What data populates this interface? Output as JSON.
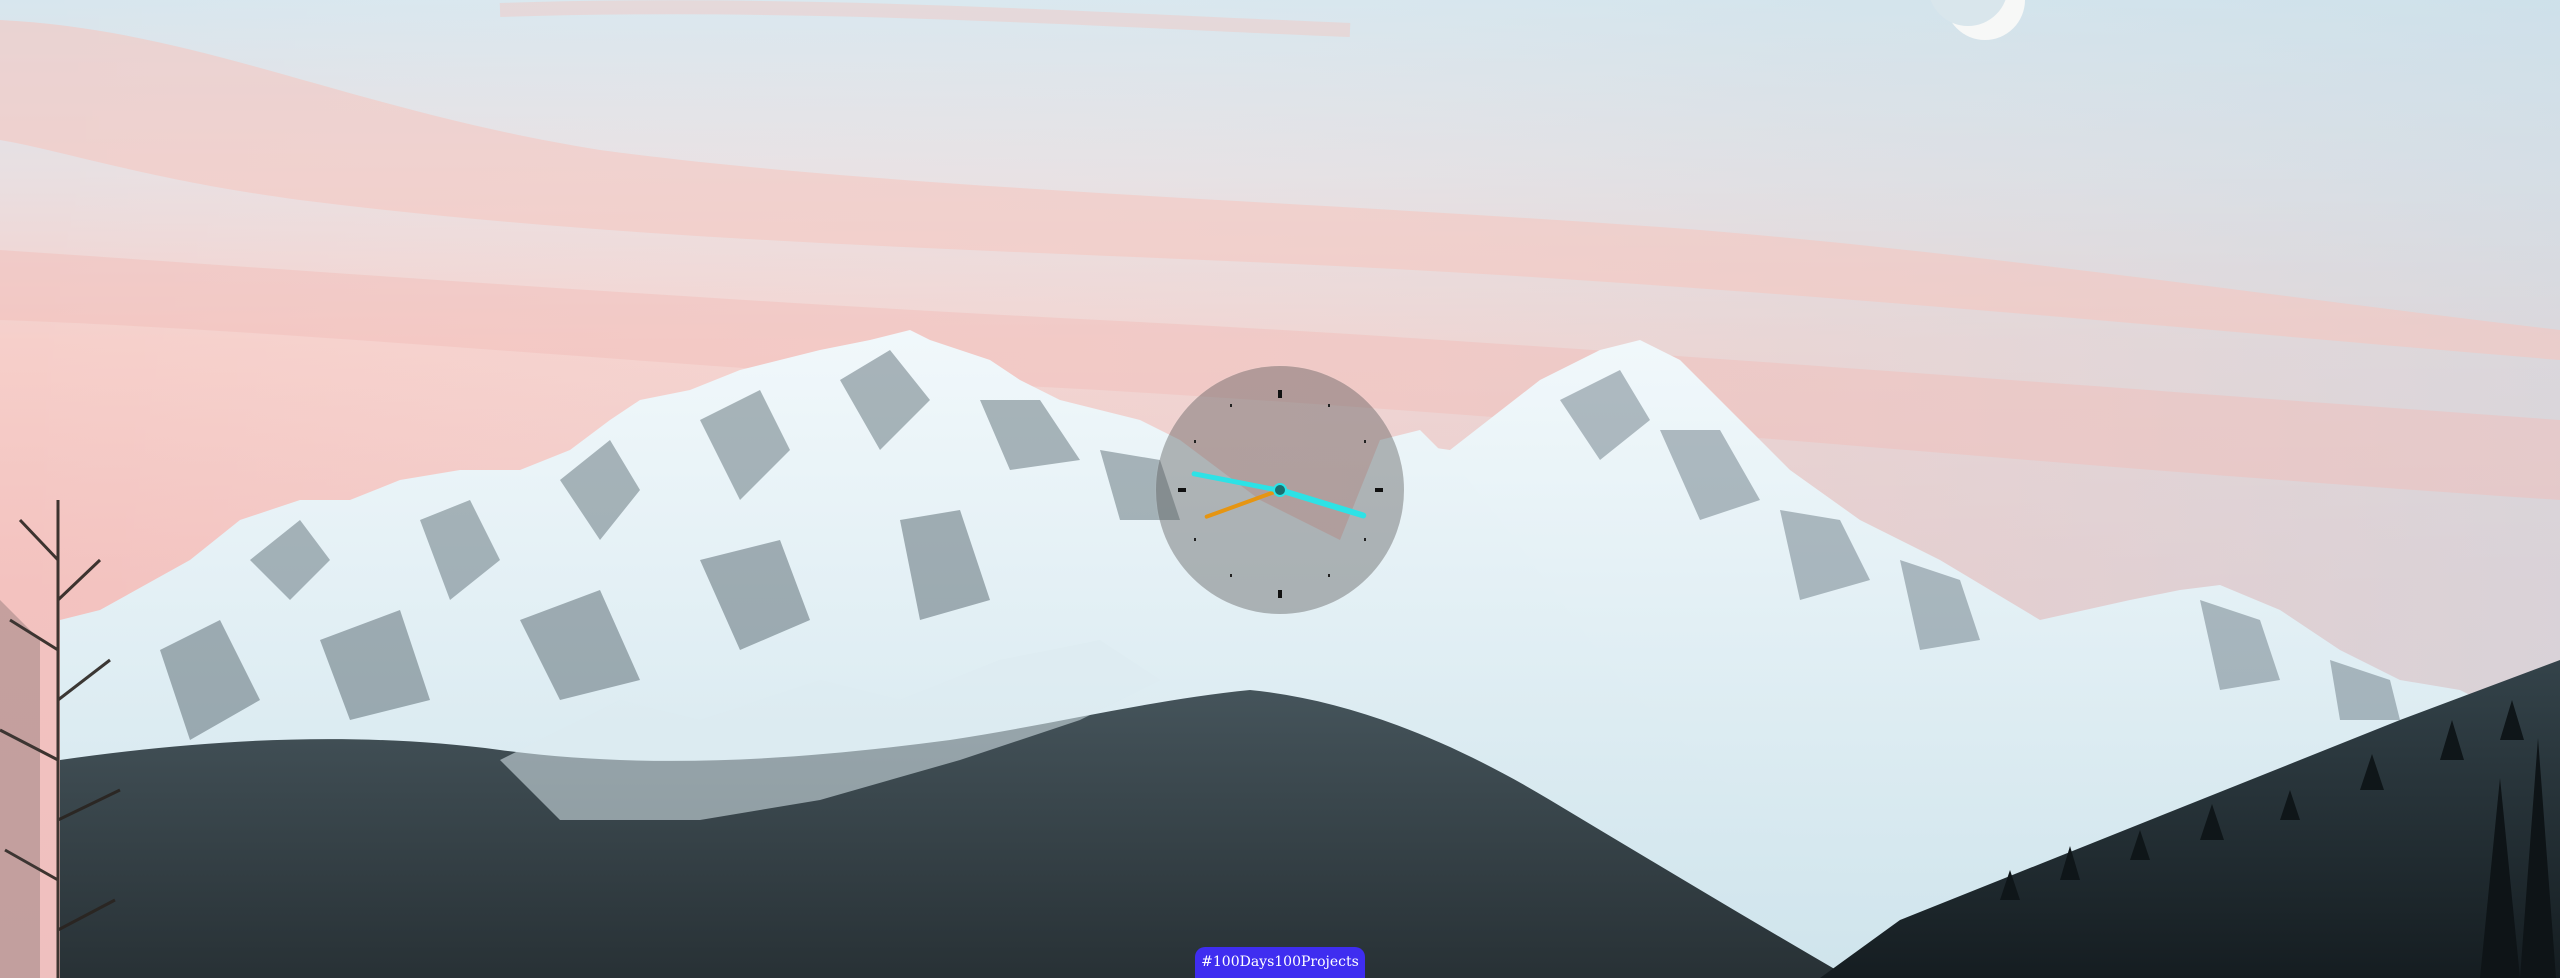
{
  "background": {
    "sky_top": "#cfe0e9",
    "sky_pink": "#f6c9c4",
    "snow": "#e8f3f7",
    "rock": "#4d5a62",
    "forest": "#1f2b30"
  },
  "clock": {
    "hand_color_primary": "#2de2e6",
    "hand_color_secondary": "#e69512"
  },
  "footer": {
    "tag_label": "#100Days100Projects",
    "tag_color": "#3f2df0"
  }
}
